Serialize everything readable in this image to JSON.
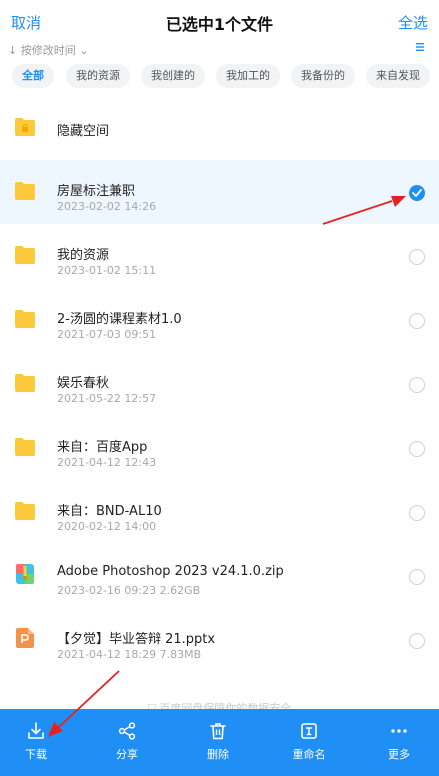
{
  "header": {
    "cancel": "取消",
    "title": "已选中1个文件",
    "select_all": "全选"
  },
  "sort": {
    "label": "按修改时间"
  },
  "filters": [
    {
      "label": "全部",
      "active": true
    },
    {
      "label": "我的资源",
      "active": false
    },
    {
      "label": "我创建的",
      "active": false
    },
    {
      "label": "我加工的",
      "active": false
    },
    {
      "label": "我备份的",
      "active": false
    },
    {
      "label": "来自发现",
      "active": false
    }
  ],
  "files": [
    {
      "name": "隐藏空间",
      "date": "",
      "size": "",
      "icon": "locked-folder-icon",
      "selected": false,
      "checkbox": false
    },
    {
      "name": "房屋标注兼职",
      "date": "2023-02-02  14:26",
      "size": "",
      "icon": "folder-icon",
      "selected": true,
      "checkbox": true
    },
    {
      "name": "我的资源",
      "date": "2023-01-02  15:11",
      "size": "",
      "icon": "folder-icon",
      "selected": false,
      "checkbox": true
    },
    {
      "name": "2-汤圆的课程素材1.0",
      "date": "2021-07-03  09:51",
      "size": "",
      "icon": "folder-icon",
      "selected": false,
      "checkbox": true
    },
    {
      "name": "娱乐春秋",
      "date": "2021-05-22  12:57",
      "size": "",
      "icon": "folder-icon",
      "selected": false,
      "checkbox": true
    },
    {
      "name": "来自：百度App",
      "date": "2021-04-12  12:43",
      "size": "",
      "icon": "folder-icon",
      "selected": false,
      "checkbox": true
    },
    {
      "name": "来自：BND-AL10",
      "date": "2020-02-12  14:00",
      "size": "",
      "icon": "folder-icon",
      "selected": false,
      "checkbox": true
    },
    {
      "name": "Adobe Photoshop 2023 v24.1.0.zip",
      "date": "2023-02-16  09:23",
      "size": "2.62GB",
      "icon": "zip-file-icon",
      "selected": false,
      "checkbox": true
    },
    {
      "name": "【夕觉】毕业答辩 21.pptx",
      "date": "2021-04-12  18:29",
      "size": "7.83MB",
      "icon": "pptx-file-icon",
      "selected": false,
      "checkbox": true
    }
  ],
  "footer_note": "百度网盘保障你的数据安全",
  "toolbar": [
    {
      "label": "下载",
      "icon": "download-icon"
    },
    {
      "label": "分享",
      "icon": "share-icon"
    },
    {
      "label": "删除",
      "icon": "trash-icon"
    },
    {
      "label": "重命名",
      "icon": "rename-icon"
    },
    {
      "label": "更多",
      "icon": "more-icon"
    }
  ],
  "colors": {
    "accent": "#1f8ff5",
    "folder": "#fdc83a",
    "annotation": "#e8201e"
  }
}
